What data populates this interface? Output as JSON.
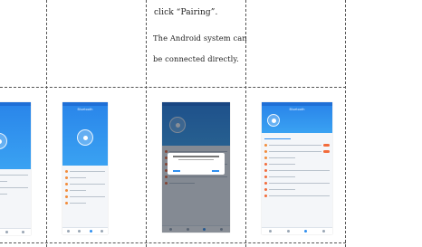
{
  "instructions": {
    "line1": "click “Pairing”.",
    "line2": "The Android system can",
    "line3": "be connected directly."
  },
  "screenshots": [
    {
      "name": "app-home-partial",
      "hero_title": ""
    },
    {
      "name": "app-bluetooth-scan",
      "hero_title": "Bluetooth"
    },
    {
      "name": "app-pairing-request",
      "hero_title": ""
    },
    {
      "name": "app-device-settings",
      "hero_title": "Bluetooth"
    }
  ],
  "colors": {
    "accent": "#2a86ea",
    "toggle": "#f26b3a",
    "grid_line": "#555555"
  }
}
